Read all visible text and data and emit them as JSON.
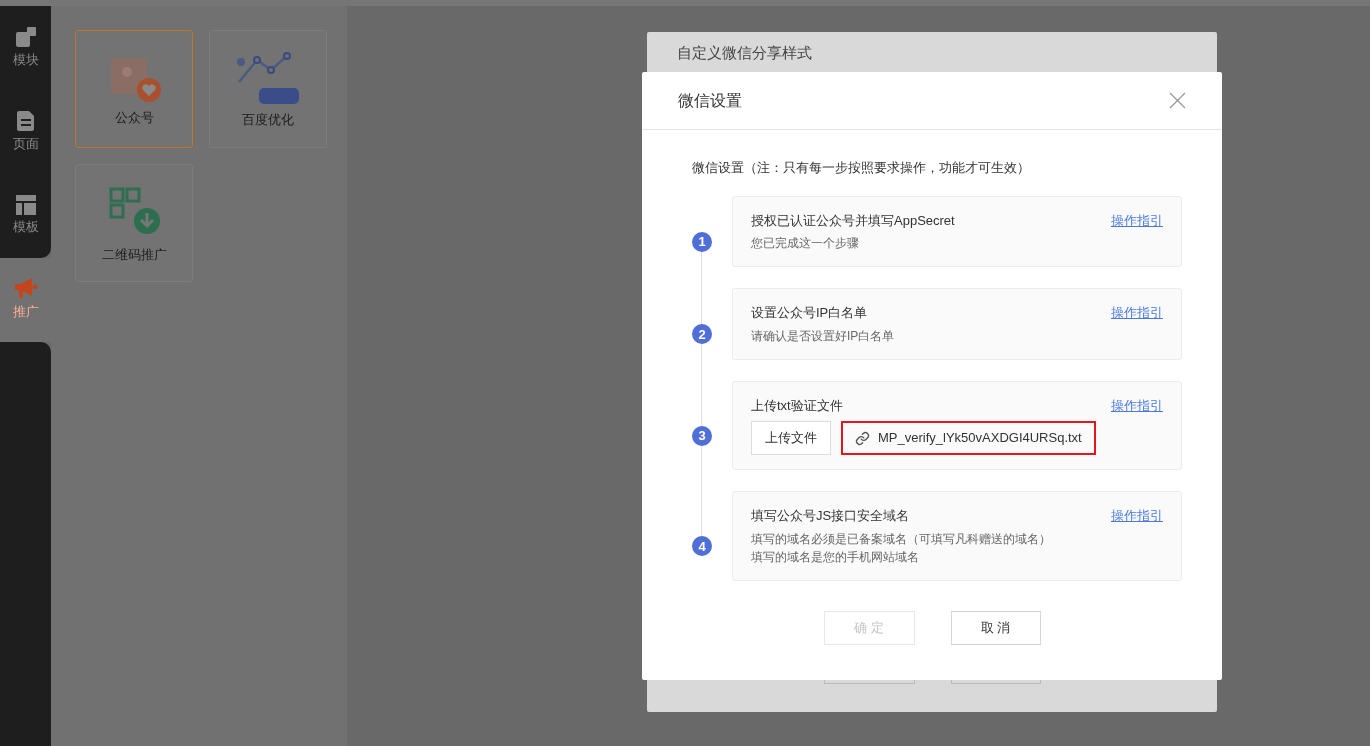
{
  "sidebar": {
    "items": [
      {
        "label": "模块",
        "selected": false
      },
      {
        "label": "页面",
        "selected": false
      },
      {
        "label": "模板",
        "selected": false
      },
      {
        "label": "推广",
        "selected": true
      }
    ]
  },
  "feature_cards": [
    {
      "label": "公众号",
      "selected": true
    },
    {
      "label": "百度优化",
      "selected": false
    },
    {
      "label": "二维码推广",
      "selected": false
    }
  ],
  "back_dialog": {
    "title": "自定义微信分享样式"
  },
  "dialog": {
    "title": "微信设置",
    "note": "微信设置（注：只有每一步按照要求操作，功能才可生效）",
    "steps": [
      {
        "number": "1",
        "kind": "text",
        "title": "授权已认证公众号并填写AppSecret",
        "lines": [
          "您已完成这一个步骤"
        ],
        "link": "操作指引"
      },
      {
        "number": "2",
        "kind": "text",
        "title": "设置公众号IP白名单",
        "lines": [
          "请确认是否设置好IP白名单"
        ],
        "link": "操作指引"
      },
      {
        "number": "3",
        "kind": "upload",
        "title": "上传txt验证文件",
        "upload_button": "上传文件",
        "file_name": "MP_verify_lYk50vAXDGI4URSq.txt",
        "link": "操作指引"
      },
      {
        "number": "4",
        "kind": "text",
        "title": "填写公众号JS接口安全域名",
        "lines": [
          "填写的域名必须是已备案域名（可填写凡科赠送的域名）",
          "填写的域名是您的手机网站域名"
        ],
        "link": "操作指引"
      }
    ],
    "buttons": [
      {
        "label": "确 定",
        "disabled": true
      },
      {
        "label": "取 消",
        "disabled": false
      }
    ]
  }
}
